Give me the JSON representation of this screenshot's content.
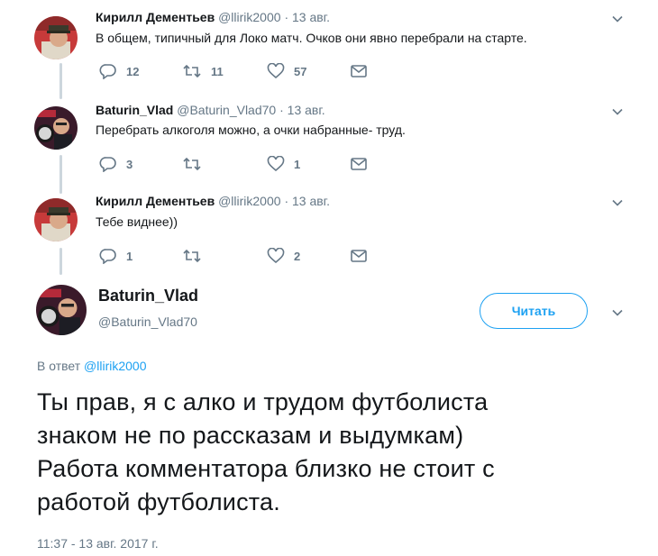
{
  "tweets": [
    {
      "name": "Кирилл Дементьев",
      "handle": "@llirik2000",
      "separator": "·",
      "date": "13 авг.",
      "text": "В общем, типичный для Локо матч. Очков они явно перебрали на старте.",
      "replies": "12",
      "retweets": "11",
      "likes": "57"
    },
    {
      "name": "Baturin_Vlad",
      "handle": "@Baturin_Vlad70",
      "separator": "·",
      "date": "13 авг.",
      "text": "Перебрать алкоголя можно, а очки набранные- труд.",
      "replies": "3",
      "retweets": "",
      "likes": "1"
    },
    {
      "name": "Кирилл Дементьев",
      "handle": "@llirik2000",
      "separator": "·",
      "date": "13 авг.",
      "text": "Тебе виднее))",
      "replies": "1",
      "retweets": "",
      "likes": "2"
    }
  ],
  "main": {
    "name": "Baturin_Vlad",
    "handle": "@Baturin_Vlad70",
    "follow_label": "Читать",
    "reply_prefix": "В ответ",
    "reply_mention": "@llirik2000",
    "text_lines": [
      "Ты прав, я с алко и трудом футболиста",
      "знаком не по рассказам и выдумкам)",
      "Работа комментатора близко не стоит с",
      "работой футболиста."
    ],
    "timestamp": "11:37 - 13 авг. 2017 г."
  },
  "colors": {
    "accent": "#1da1f2",
    "muted": "#657786",
    "text": "#14171a",
    "thread_line": "#ccd6dd"
  },
  "icons": {
    "reply": "reply-icon",
    "retweet": "retweet-icon",
    "like": "heart-icon",
    "dm": "envelope-icon",
    "more": "chevron-down-icon"
  }
}
